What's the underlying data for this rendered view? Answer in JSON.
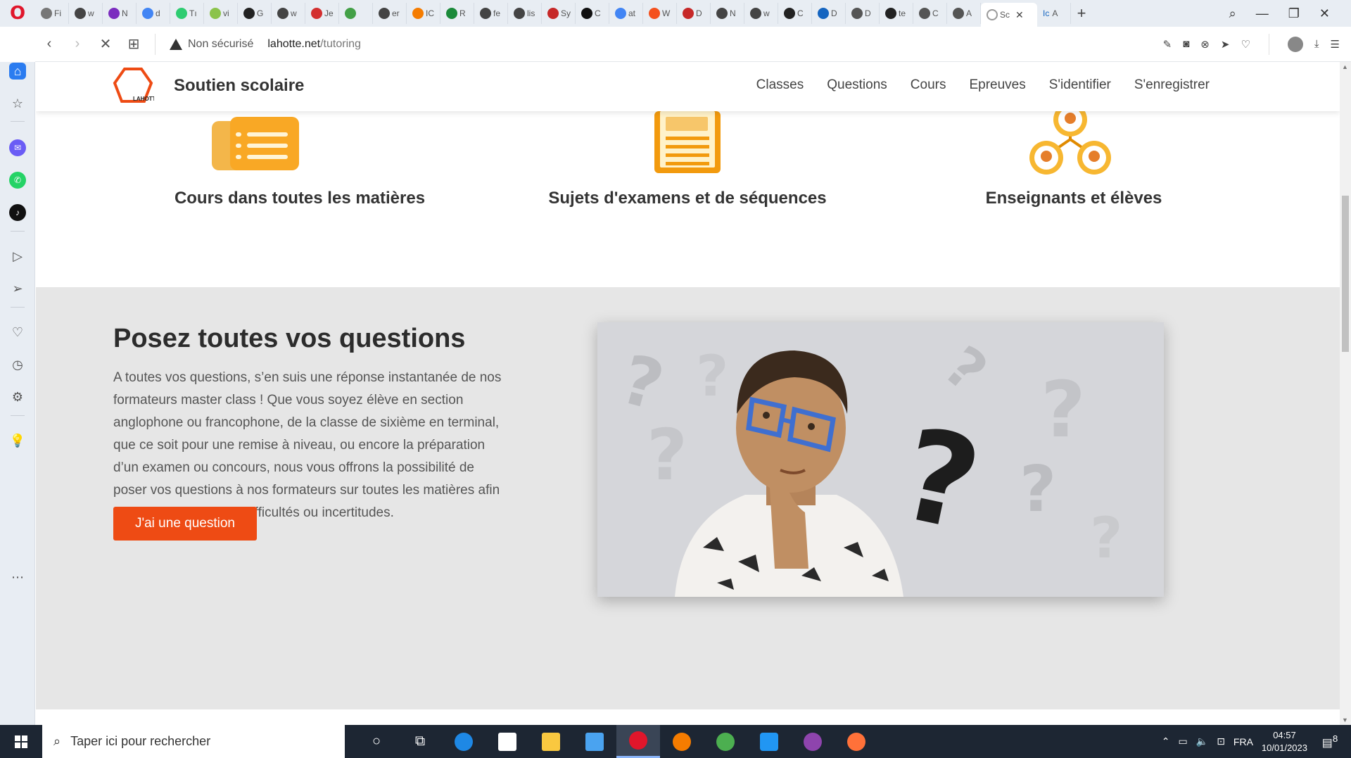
{
  "browser": {
    "tabs": [
      {
        "label": "Fi",
        "color": "#777"
      },
      {
        "label": "w",
        "color": "#444"
      },
      {
        "label": "N",
        "color": "#7b2cbf"
      },
      {
        "label": "d",
        "color": "#4285f4"
      },
      {
        "label": "Tı",
        "color": "#2ecc71"
      },
      {
        "label": "vi",
        "color": "#8bc34a"
      },
      {
        "label": "G",
        "color": "#222"
      },
      {
        "label": "w",
        "color": "#444"
      },
      {
        "label": "Je",
        "color": "#d32f2f"
      },
      {
        "label": "",
        "color": "#43a047"
      },
      {
        "label": "er",
        "color": "#444"
      },
      {
        "label": "IC",
        "color": "#f57c00"
      },
      {
        "label": "R",
        "color": "#1b8a3a"
      },
      {
        "label": "fe",
        "color": "#444"
      },
      {
        "label": "lis",
        "color": "#444"
      },
      {
        "label": "Sy",
        "color": "#c62828"
      },
      {
        "label": "C",
        "color": "#111"
      },
      {
        "label": "at",
        "color": "#4285f4"
      },
      {
        "label": "W",
        "color": "#f4511e"
      },
      {
        "label": "D",
        "color": "#c62828"
      },
      {
        "label": "N",
        "color": "#444"
      },
      {
        "label": "w",
        "color": "#444"
      },
      {
        "label": "C",
        "color": "#222"
      },
      {
        "label": "D",
        "color": "#1565c0"
      },
      {
        "label": "D",
        "color": "#555"
      },
      {
        "label": "te",
        "color": "#222"
      },
      {
        "label": "C",
        "color": "#555"
      },
      {
        "label": "A",
        "color": "#555"
      }
    ],
    "active_tab": {
      "label": "Sc",
      "close": "✕"
    },
    "after_tab": {
      "label": "A",
      "prefix": "Ic"
    },
    "new_tab": "+",
    "security_label": "Non sécurisé",
    "url_host": "lahotte.net",
    "url_path": "/tutoring"
  },
  "site": {
    "name": "Soutien scolaire",
    "logo_text": "LAHOTTE",
    "nav": [
      "Classes",
      "Questions",
      "Cours",
      "Epreuves",
      "S'identifier",
      "S'enregistrer"
    ],
    "accent": "#ee4b14"
  },
  "features": [
    {
      "title": "Cours dans toutes les matières",
      "icon": "notes-icon"
    },
    {
      "title": "Sujets d'examens et de séquences",
      "icon": "document-icon"
    },
    {
      "title": "Enseignants et élèves",
      "icon": "people-network-icon"
    }
  ],
  "questions": {
    "title": "Posez toutes vos questions",
    "text": "A toutes vos questions, s’en suis une réponse instantanée de nos formateurs master class ! Que vous soyez élève en section anglophone ou francophone, de la classe de sixième en terminal, que ce soit pour une remise à niveau, ou encore la préparation d’un examen ou concours, nous vous offrons la possibilité de poser vos questions à nos formateurs sur toutes les matières afin de palier à toutes vos difficultés ou incertitudes.",
    "button": "J'ai une question"
  },
  "taskbar": {
    "search_placeholder": "Taper ici pour rechercher",
    "language": "FRA",
    "time": "04:57",
    "date": "10/01/2023",
    "notifications": "8"
  }
}
